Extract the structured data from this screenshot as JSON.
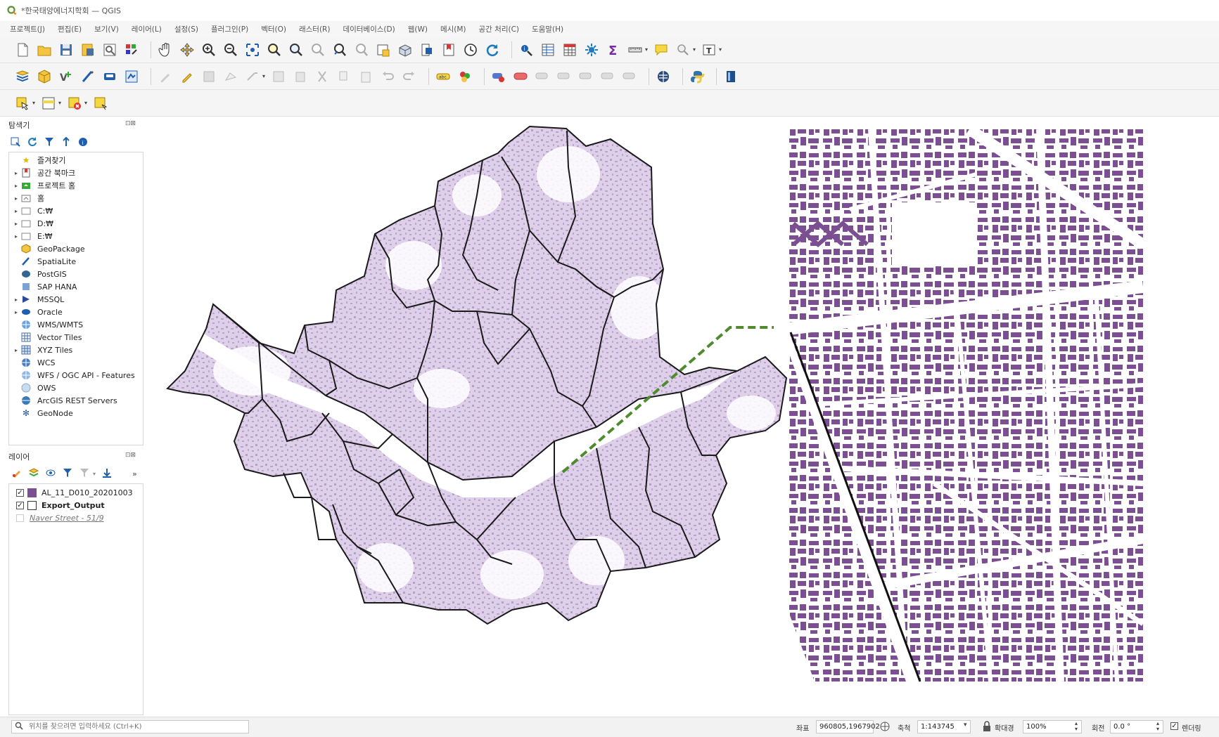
{
  "window": {
    "title": "*한국태양에너지학회 — QGIS"
  },
  "menu": [
    "프로젝트(J)",
    "편집(E)",
    "보기(V)",
    "레이어(L)",
    "설정(S)",
    "플러그인(P)",
    "벡터(O)",
    "래스터(R)",
    "데이터베이스(D)",
    "웹(W)",
    "메시(M)",
    "공간 처리(C)",
    "도움말(H)"
  ],
  "browser": {
    "title": "탐색기",
    "controls": "⊡⊠",
    "items": [
      {
        "label": "즐겨찾기",
        "icon": "star-icon"
      },
      {
        "label": "공간 북마크",
        "icon": "bookmark-icon"
      },
      {
        "label": "프로젝트 홈",
        "icon": "project-home-icon"
      },
      {
        "label": "홈",
        "icon": "home-icon"
      },
      {
        "label": "C:₩",
        "icon": "drive-icon"
      },
      {
        "label": "D:₩",
        "icon": "drive-icon"
      },
      {
        "label": "E:₩",
        "icon": "drive-icon"
      },
      {
        "label": "GeoPackage",
        "icon": "geopackage-icon"
      },
      {
        "label": "SpatiaLite",
        "icon": "spatialite-icon"
      },
      {
        "label": "PostGIS",
        "icon": "postgis-icon"
      },
      {
        "label": "SAP HANA",
        "icon": "sap-hana-icon"
      },
      {
        "label": "MSSQL",
        "icon": "mssql-icon"
      },
      {
        "label": "Oracle",
        "icon": "oracle-icon"
      },
      {
        "label": "WMS/WMTS",
        "icon": "globe-icon"
      },
      {
        "label": "Vector Tiles",
        "icon": "grid-icon"
      },
      {
        "label": "XYZ Tiles",
        "icon": "grid-icon"
      },
      {
        "label": "WCS",
        "icon": "globe-icon"
      },
      {
        "label": "WFS / OGC API - Features",
        "icon": "globe-icon"
      },
      {
        "label": "OWS",
        "icon": "globe-icon"
      },
      {
        "label": "ArcGIS REST Servers",
        "icon": "globe-icon"
      },
      {
        "label": "GeoNode",
        "icon": "geonode-icon"
      }
    ]
  },
  "layers": {
    "title": "레이어",
    "controls": "⊡⊠",
    "overflow": "»",
    "items": [
      {
        "name": "AL_11_D010_20201003",
        "checked": "✓",
        "color": "#7b4f91"
      },
      {
        "name": "Export_Output",
        "checked": "✓",
        "color": "#ffffff"
      },
      {
        "name": "Naver Street - 51/9",
        "checked": "",
        "color": ""
      }
    ]
  },
  "colors": {
    "buildings": "#7b4f91",
    "district_fill": "#c9b0d8",
    "callout": "#4e8b2c"
  },
  "status": {
    "locator_placeholder": "위치를 찾으려면 입력하세요 (Ctrl+K)",
    "coord_label": "좌표",
    "coord_value": "960805,1967902",
    "scale_label": "축척",
    "scale_value": "1:143745",
    "magnifier_label": "확대경",
    "magnifier_value": "100%",
    "rotation_label": "회전",
    "rotation_value": "0.0 °",
    "render_label": "렌더링"
  }
}
